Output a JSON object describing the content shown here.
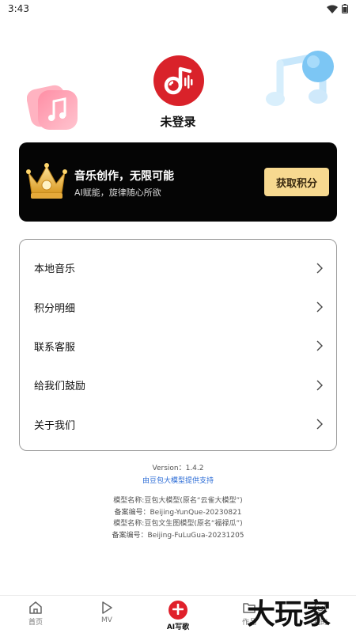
{
  "status_bar": {
    "time": "3:43",
    "icons": [
      "wifi-icon",
      "battery-icon"
    ]
  },
  "profile": {
    "logo_icon": "music-note-logo-icon",
    "login_status": "未登录"
  },
  "promo": {
    "title": "音乐创作，无限可能",
    "subtitle": "AI赋能，旋律随心所欲",
    "button_label": "获取积分",
    "icon": "crown-icon"
  },
  "menu": {
    "items": [
      {
        "label": "本地音乐"
      },
      {
        "label": "积分明细"
      },
      {
        "label": "联系客服"
      },
      {
        "label": "给我们鼓励"
      },
      {
        "label": "关于我们"
      }
    ]
  },
  "footer": {
    "version": "Version：1.4.2",
    "support_link": "由豆包大模型提供支持",
    "model_lines": [
      "模型名称:豆包大模型(原名“云雀大模型”)",
      "备案编号：Beijing-YunQue-20230821",
      "模型名称:豆包文生图模型(原名“福禄瓜”)",
      "备案编号：Beijing-FuLuGua-20231205"
    ]
  },
  "tabbar": {
    "tabs": [
      {
        "label": "首页",
        "icon": "home-icon"
      },
      {
        "label": "MV",
        "icon": "play-icon"
      },
      {
        "label": "AI写歌",
        "icon": "add-icon"
      },
      {
        "label": "作品",
        "icon": "folder-icon"
      },
      {
        "label": "我的",
        "icon": "profile-icon"
      }
    ]
  },
  "watermark": "大玩家",
  "colors": {
    "brand_red": "#d9222a",
    "promo_bg": "#050505",
    "promo_button": "#f7d990",
    "link_blue": "#2a6bd6"
  }
}
